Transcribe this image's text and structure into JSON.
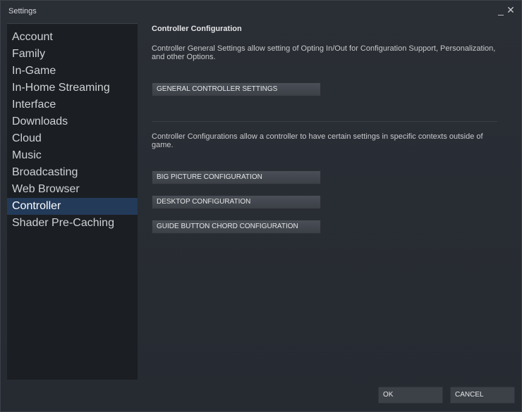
{
  "window": {
    "title": "Settings",
    "minimize_label": "_",
    "close_label": "✕"
  },
  "sidebar": {
    "items": [
      {
        "label": "Account"
      },
      {
        "label": "Family"
      },
      {
        "label": "In-Game"
      },
      {
        "label": "In-Home Streaming"
      },
      {
        "label": "Interface"
      },
      {
        "label": "Downloads"
      },
      {
        "label": "Cloud"
      },
      {
        "label": "Music"
      },
      {
        "label": "Broadcasting"
      },
      {
        "label": "Web Browser"
      },
      {
        "label": "Controller",
        "selected": true
      },
      {
        "label": "Shader Pre-Caching"
      }
    ]
  },
  "main": {
    "heading": "Controller Configuration",
    "general_description": "Controller General Settings allow setting of Opting In/Out for Configuration Support, Personalization, and other Options.",
    "general_button": "GENERAL CONTROLLER SETTINGS",
    "configs_description": "Controller Configurations allow a controller to have certain settings in specific contexts outside of game.",
    "big_picture_button": "BIG PICTURE CONFIGURATION",
    "desktop_button": "DESKTOP CONFIGURATION",
    "guide_chord_button": "GUIDE BUTTON CHORD CONFIGURATION"
  },
  "footer": {
    "ok_label": "OK",
    "cancel_label": "CANCEL"
  },
  "colors": {
    "selected_item_bg": "#233a59",
    "window_bg": "#262a31",
    "sidebar_bg": "#1b1e23"
  }
}
